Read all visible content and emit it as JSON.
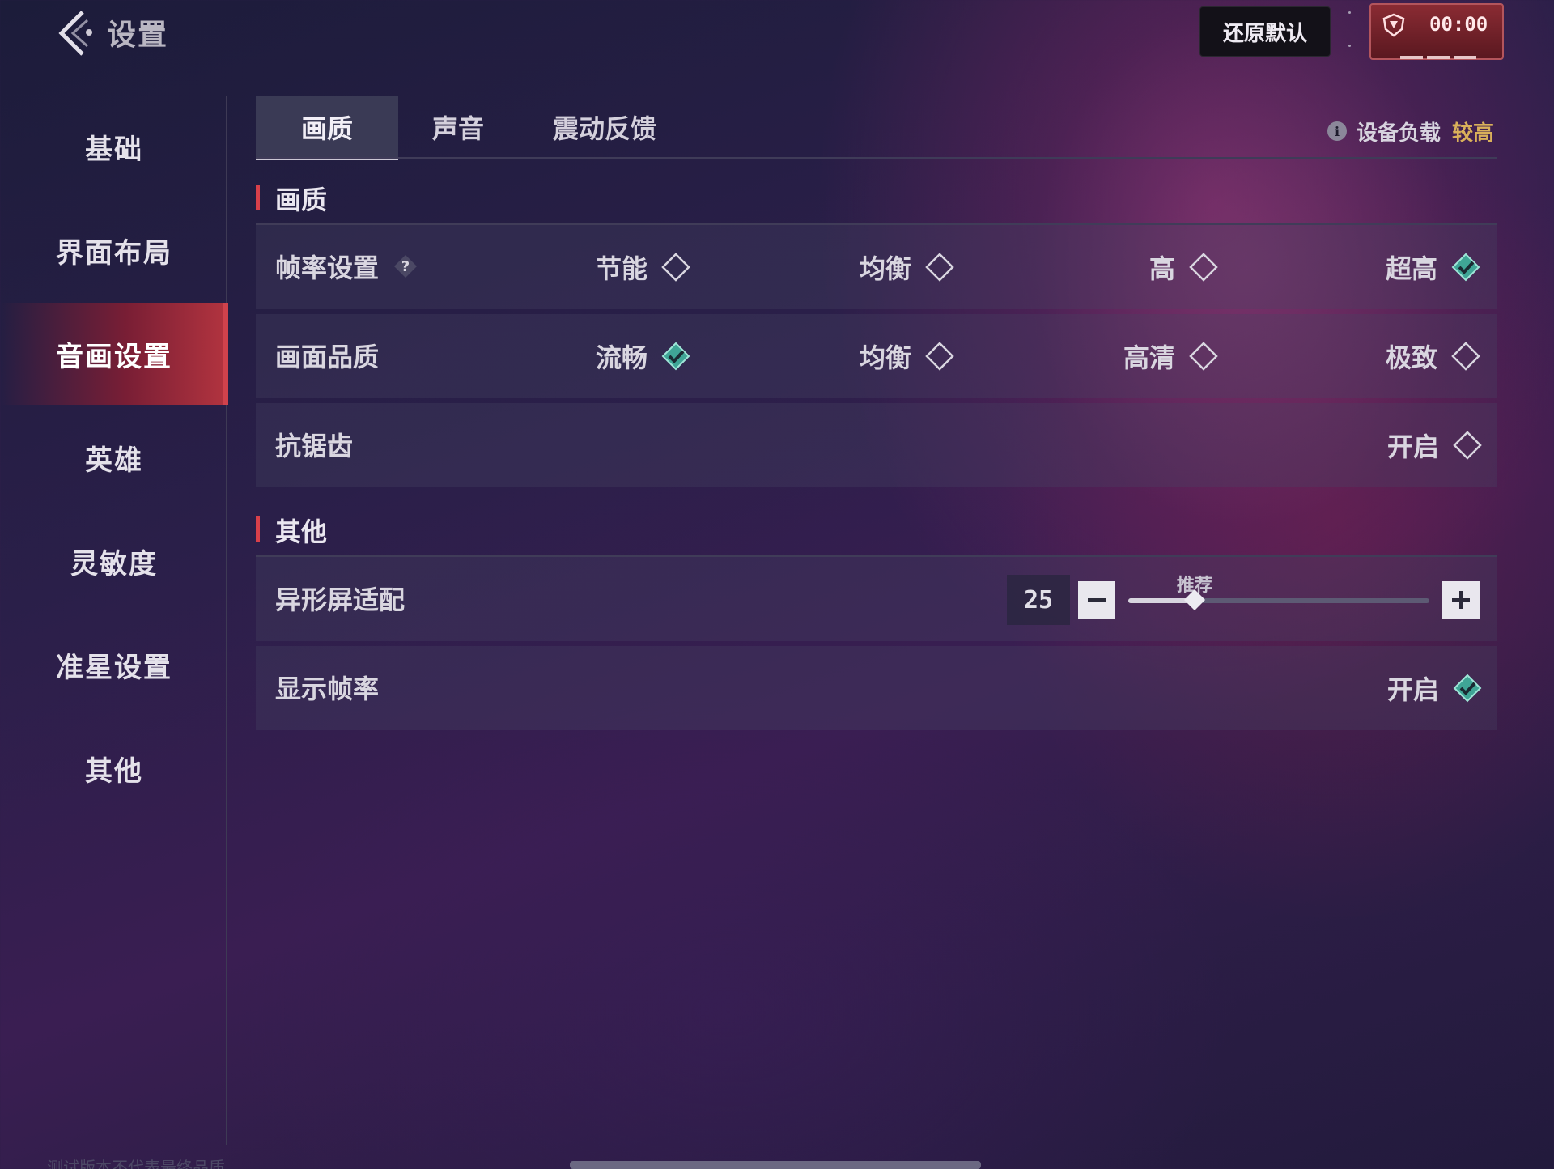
{
  "header": {
    "title": "设置",
    "restore_label": "还原默认",
    "timer": "00:00"
  },
  "sidebar": {
    "items": [
      {
        "label": "基础",
        "active": false
      },
      {
        "label": "界面布局",
        "active": false
      },
      {
        "label": "音画设置",
        "active": true
      },
      {
        "label": "英雄",
        "active": false
      },
      {
        "label": "灵敏度",
        "active": false
      },
      {
        "label": "准星设置",
        "active": false
      },
      {
        "label": "其他",
        "active": false
      }
    ]
  },
  "tabs": [
    {
      "label": "画质",
      "active": true
    },
    {
      "label": "声音",
      "active": false
    },
    {
      "label": "震动反馈",
      "active": false
    }
  ],
  "device_load": {
    "label": "设备负载",
    "value": "较高"
  },
  "sections": {
    "quality": {
      "title": "画质",
      "frame_rate": {
        "label": "帧率设置",
        "options": [
          "节能",
          "均衡",
          "高",
          "超高"
        ],
        "selected": "超高"
      },
      "picture_quality": {
        "label": "画面品质",
        "options": [
          "流畅",
          "均衡",
          "高清",
          "极致"
        ],
        "selected": "流畅"
      },
      "anti_alias": {
        "label": "抗锯齿",
        "option": "开启",
        "checked": false
      }
    },
    "other": {
      "title": "其他",
      "notch": {
        "label": "异形屏适配",
        "value": "25",
        "recommend_label": "推荐",
        "fraction": 0.22
      },
      "show_fps": {
        "label": "显示帧率",
        "option": "开启",
        "checked": true
      }
    }
  },
  "footer": {
    "note": "测试版本不代表最终品质"
  },
  "colors": {
    "accent": "#d8404a",
    "checked": "#5ec4b0",
    "load_value": "#d9b05a"
  }
}
